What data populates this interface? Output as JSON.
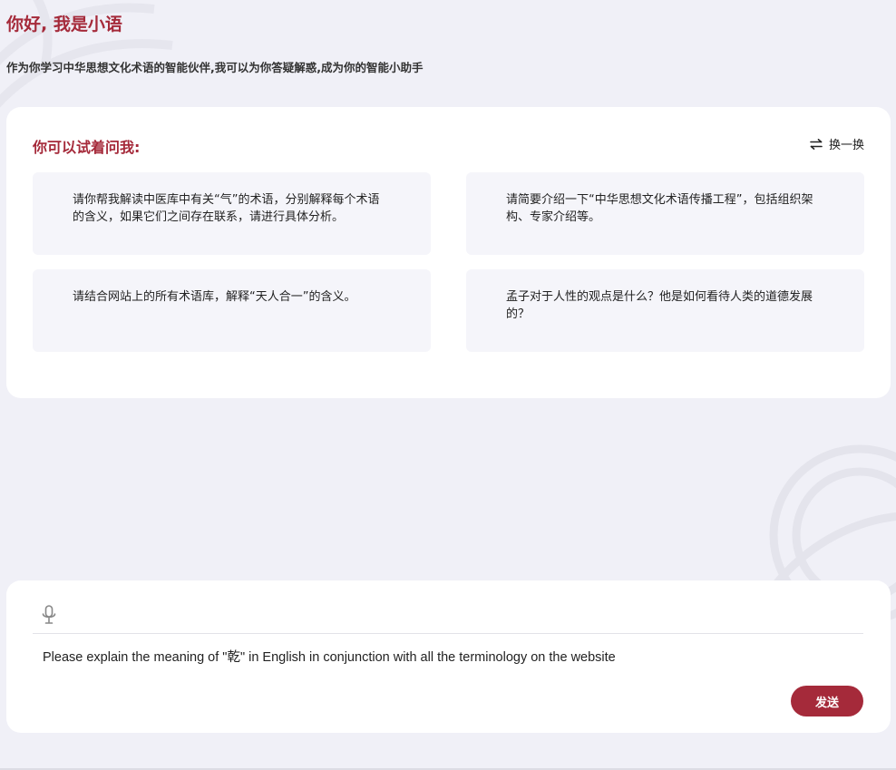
{
  "greeting": {
    "title": "你好, 我是小语",
    "subtitle": "作为你学习中华思想文化术语的智能伙伴,我可以为你答疑解惑,成为你的智能小助手"
  },
  "suggestions": {
    "heading": "你可以试着问我:",
    "refresh_label": "换一换",
    "items": [
      {
        "text": "请你帮我解读中医库中有关“气”的术语，分别解释每个术语的含义，如果它们之间存在联系，请进行具体分析。"
      },
      {
        "text": "请简要介绍一下“中华思想文化术语传播工程”，包括组织架构、专家介绍等。"
      },
      {
        "text": "请结合网站上的所有术语库，解释“天人合一”的含义。"
      },
      {
        "text": "孟子对于人性的观点是什么？他是如何看待人类的道德发展的？"
      }
    ]
  },
  "input_panel": {
    "query_value": "Please explain the meaning of \"乾\" in English in conjunction with all the terminology on the website",
    "send_label": "发送"
  },
  "colors": {
    "accent": "#a52a3a",
    "background": "#f0f0f7",
    "card": "#ffffff",
    "suggestion_bg": "#f5f5fa"
  },
  "icons": {
    "mic": "microphone-icon",
    "refresh": "swap-arrows-icon"
  }
}
